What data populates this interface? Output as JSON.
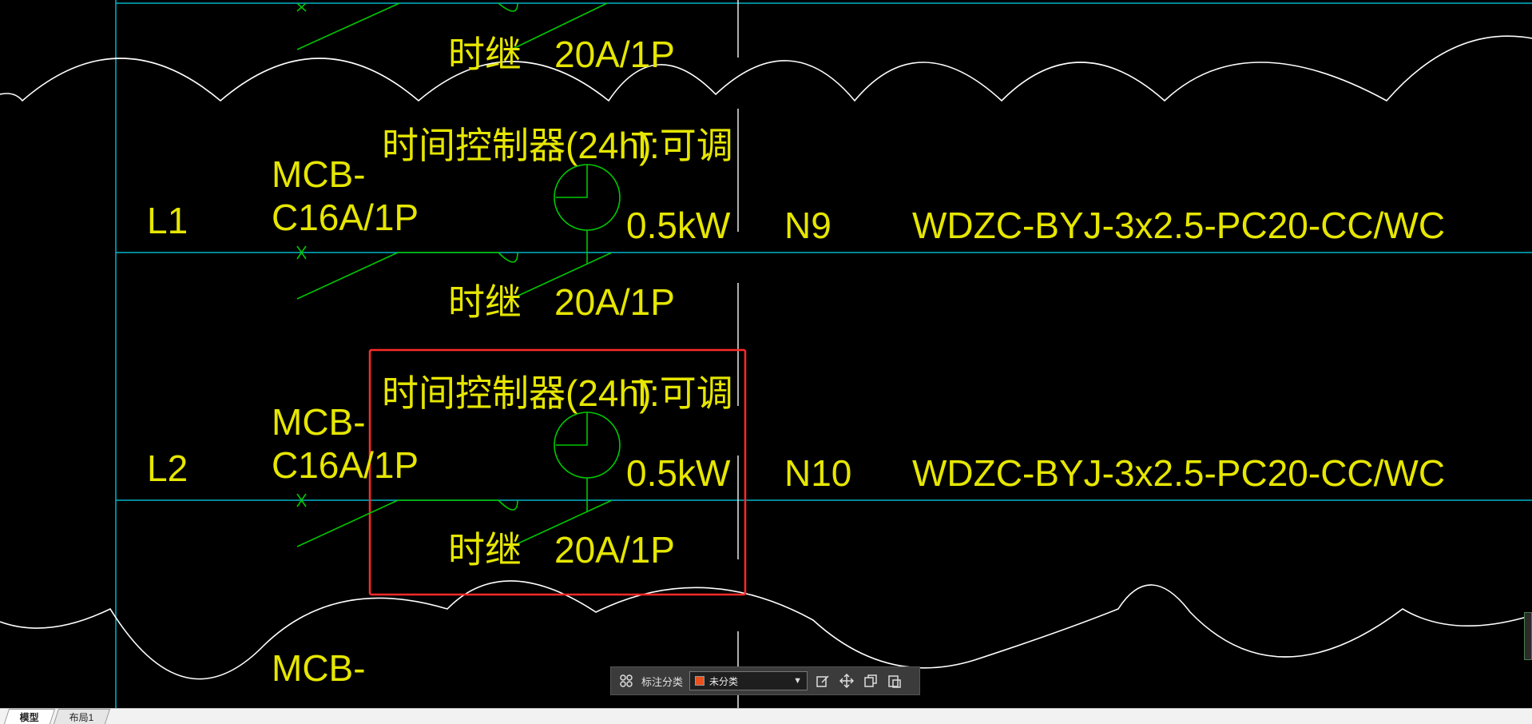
{
  "drawing": {
    "circuits": [
      {
        "id": "top",
        "relay_label": "时继",
        "relay_rating": "20A/1P"
      },
      {
        "id": "L1",
        "line_label": "L1",
        "breaker_line1": "MCB-",
        "breaker_line2": "C16A/1P",
        "timer_label": "时间控制器(24h)",
        "time_label": "T:可调",
        "power": "0.5kW",
        "circuit_no": "N9",
        "cable": "WDZC-BYJ-3x2.5-PC20-CC/WC",
        "relay_label": "时继",
        "relay_rating": "20A/1P"
      },
      {
        "id": "L2",
        "line_label": "L2",
        "breaker_line1": "MCB-",
        "breaker_line2": "C16A/1P",
        "timer_label": "时间控制器(24h)",
        "time_label": "T:可调",
        "power": "0.5kW",
        "circuit_no": "N10",
        "cable": "WDZC-BYJ-3x2.5-PC20-CC/WC",
        "relay_label": "时继",
        "relay_rating": "20A/1P"
      },
      {
        "id": "bottom",
        "breaker_line1": "MCB-"
      }
    ],
    "colors": {
      "background": "#000000",
      "text": "#e6e600",
      "circuit": "#00c800",
      "wire": "#00b4c8",
      "revision_cloud": "#ffffff",
      "selection_box": "#ff2a2a"
    }
  },
  "toolbar": {
    "grid_icon": "grid-icon",
    "label": "标注分类",
    "category_value": "未分类",
    "category_color": "#e8501e",
    "icons": [
      "edit-icon",
      "move-icon",
      "copy-icon",
      "paste-icon"
    ]
  },
  "tabs": {
    "model": "模型",
    "layout1": "布局1"
  }
}
